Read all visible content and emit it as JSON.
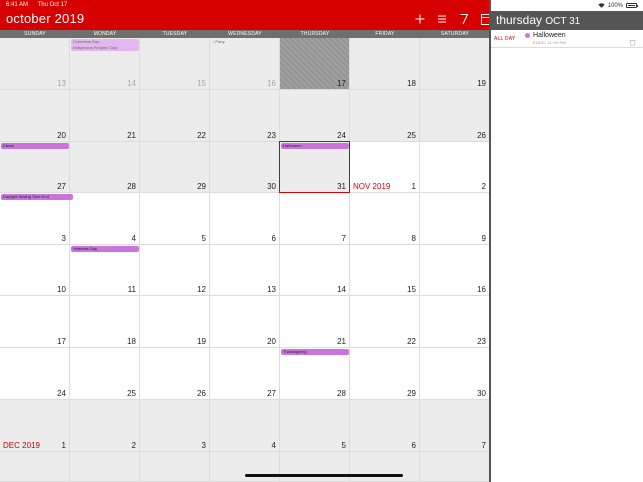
{
  "status": {
    "time": "6:41 AM",
    "date": "Thu Oct 17",
    "battery": "100%",
    "battery_level": 1.0
  },
  "header": {
    "month": "october",
    "year": "2019",
    "actions": [
      {
        "name": "add",
        "glyph": "+"
      },
      {
        "name": "list",
        "glyph": "≡"
      },
      {
        "name": "today",
        "glyph": "7"
      },
      {
        "name": "toggle-panel",
        "glyph": "▭"
      }
    ]
  },
  "weekdays": [
    "SUNDAY",
    "MONDAY",
    "TUESDAY",
    "WEDNESDAY",
    "THURSDAY",
    "FRIDAY",
    "SATURDAY"
  ],
  "weeks": [
    [
      {
        "day": "13",
        "state": "past-faded"
      },
      {
        "day": "14",
        "state": "past-faded"
      },
      {
        "day": "15",
        "state": "past-faded"
      },
      {
        "day": "16",
        "state": "past-faded"
      },
      {
        "day": "17",
        "state": "today"
      },
      {
        "day": "18",
        "state": "past"
      },
      {
        "day": "19",
        "state": "past"
      }
    ],
    [
      {
        "day": "20",
        "state": "past"
      },
      {
        "day": "21",
        "state": "past"
      },
      {
        "day": "22",
        "state": "past"
      },
      {
        "day": "23",
        "state": "past"
      },
      {
        "day": "24",
        "state": "past"
      },
      {
        "day": "25",
        "state": "past"
      },
      {
        "day": "26",
        "state": "past"
      }
    ],
    [
      {
        "day": "27",
        "state": "past"
      },
      {
        "day": "28",
        "state": "past"
      },
      {
        "day": "29",
        "state": "past"
      },
      {
        "day": "30",
        "state": "past"
      },
      {
        "day": "31",
        "state": "past"
      },
      {
        "day": "1",
        "state": "future",
        "month_label": "NOV 2019"
      },
      {
        "day": "2",
        "state": "future"
      }
    ],
    [
      {
        "day": "3",
        "state": "future"
      },
      {
        "day": "4",
        "state": "future"
      },
      {
        "day": "5",
        "state": "future"
      },
      {
        "day": "6",
        "state": "future"
      },
      {
        "day": "7",
        "state": "future"
      },
      {
        "day": "8",
        "state": "future"
      },
      {
        "day": "9",
        "state": "future"
      }
    ],
    [
      {
        "day": "10",
        "state": "future"
      },
      {
        "day": "11",
        "state": "future"
      },
      {
        "day": "12",
        "state": "future"
      },
      {
        "day": "13",
        "state": "future"
      },
      {
        "day": "14",
        "state": "future"
      },
      {
        "day": "15",
        "state": "future"
      },
      {
        "day": "16",
        "state": "future"
      }
    ],
    [
      {
        "day": "17",
        "state": "future"
      },
      {
        "day": "18",
        "state": "future"
      },
      {
        "day": "19",
        "state": "future"
      },
      {
        "day": "20",
        "state": "future"
      },
      {
        "day": "21",
        "state": "future"
      },
      {
        "day": "22",
        "state": "future"
      },
      {
        "day": "23",
        "state": "future"
      }
    ],
    [
      {
        "day": "24",
        "state": "future"
      },
      {
        "day": "25",
        "state": "future"
      },
      {
        "day": "26",
        "state": "future"
      },
      {
        "day": "27",
        "state": "future"
      },
      {
        "day": "28",
        "state": "future"
      },
      {
        "day": "29",
        "state": "future"
      },
      {
        "day": "30",
        "state": "future"
      }
    ],
    [
      {
        "day": "1",
        "state": "dec",
        "month_label": "DEC 2019"
      },
      {
        "day": "2",
        "state": "dec"
      },
      {
        "day": "3",
        "state": "dec"
      },
      {
        "day": "4",
        "state": "dec"
      },
      {
        "day": "5",
        "state": "dec"
      },
      {
        "day": "6",
        "state": "dec"
      },
      {
        "day": "7",
        "state": "dec"
      }
    ],
    [
      {
        "day": "",
        "state": "dec"
      },
      {
        "day": "",
        "state": "dec"
      },
      {
        "day": "",
        "state": "dec"
      },
      {
        "day": "",
        "state": "dec"
      },
      {
        "day": "",
        "state": "dec"
      },
      {
        "day": "",
        "state": "dec"
      },
      {
        "day": "",
        "state": "dec"
      }
    ]
  ],
  "events": [
    {
      "title": "Columbus Day",
      "week": 0,
      "col": 1,
      "span": 1,
      "row": 0,
      "style": "lilac"
    },
    {
      "title": "Indigenous Peoples' Day",
      "week": 0,
      "col": 1,
      "span": 1,
      "row": 1,
      "style": "lilac"
    },
    {
      "title": "Party",
      "week": 0,
      "col": 3,
      "span": 1,
      "row": 0,
      "style": "dot"
    },
    {
      "title": "Diwali",
      "week": 2,
      "col": 0,
      "span": 1,
      "row": 0,
      "style": "purple"
    },
    {
      "title": "Halloween",
      "week": 2,
      "col": 4,
      "span": 1,
      "row": 0,
      "style": "purple"
    },
    {
      "title": "Daylight Saving Time End",
      "week": 3,
      "col": 0,
      "span": 1,
      "row": 0,
      "style": "purple"
    },
    {
      "title": "Veterans Day",
      "week": 4,
      "col": 1,
      "span": 1,
      "row": 0,
      "style": "purple"
    },
    {
      "title": "Thanksgiving",
      "week": 6,
      "col": 4,
      "span": 1,
      "row": 0,
      "style": "purple"
    }
  ],
  "selected": {
    "week": 2,
    "col": 4
  },
  "panel": {
    "weekday": "thursday",
    "date": "OCT 31",
    "allday_label": "ALL DAY",
    "event_title": "Halloween",
    "event_sub": "ENDS: 11:59 PM"
  },
  "colors": {
    "accent": "#d60000",
    "event_purple": "#c975dd",
    "event_lilac": "#e3b7ee",
    "past_bg": "#ececec",
    "weekday_bar": "#6f6f6f",
    "panel_header": "#555555"
  }
}
